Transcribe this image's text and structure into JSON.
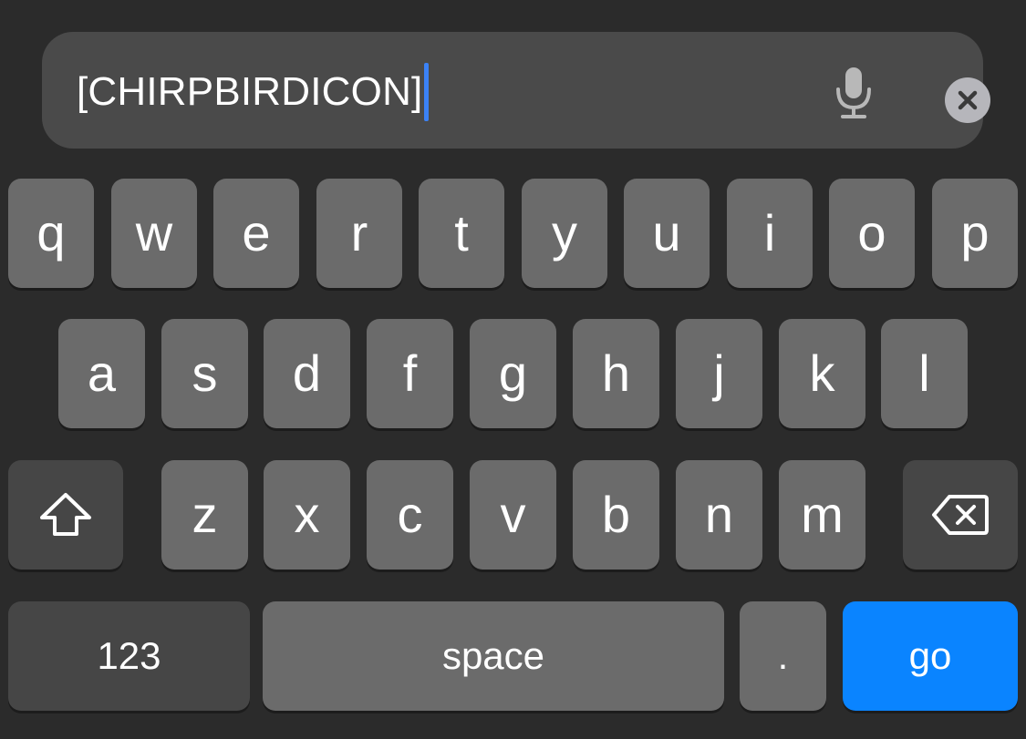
{
  "search": {
    "text": "[CHIRPBIRDICON]",
    "mic_icon": "microphone-icon",
    "clear_icon": "clear-x-icon"
  },
  "keyboard": {
    "row1": [
      "q",
      "w",
      "e",
      "r",
      "t",
      "y",
      "u",
      "i",
      "o",
      "p"
    ],
    "row2": [
      "a",
      "s",
      "d",
      "f",
      "g",
      "h",
      "j",
      "k",
      "l"
    ],
    "row3": [
      "z",
      "x",
      "c",
      "v",
      "b",
      "n",
      "m"
    ],
    "shift_icon": "shift-arrow-icon",
    "backspace_icon": "backspace-icon",
    "numbers_label": "123",
    "space_label": "space",
    "period_label": ".",
    "go_label": "go"
  },
  "colors": {
    "background": "#2b2b2b",
    "field": "#4a4a4a",
    "key": "#6b6b6b",
    "key_dark": "#464646",
    "go_key": "#0a84ff",
    "caret": "#3b82f6"
  }
}
